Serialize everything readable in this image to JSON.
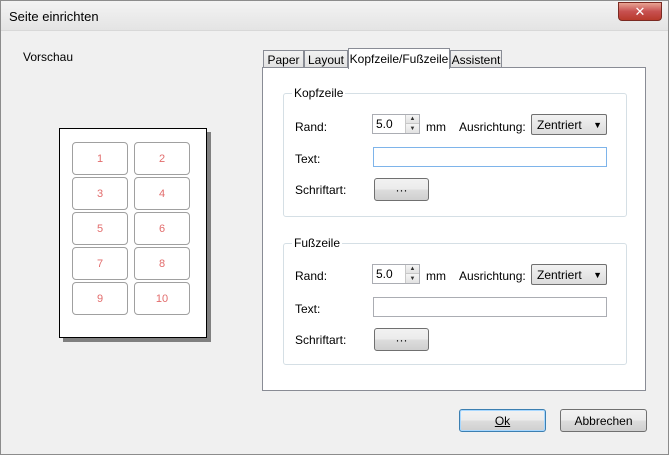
{
  "window": {
    "title": "Seite einrichten",
    "close_glyph": "✕"
  },
  "preview": {
    "label": "Vorschau",
    "cells": [
      "1",
      "2",
      "3",
      "4",
      "5",
      "6",
      "7",
      "8",
      "9",
      "10"
    ]
  },
  "tabs": [
    {
      "label": "Paper",
      "active": false
    },
    {
      "label": "Layout",
      "active": false
    },
    {
      "label": "Kopfzeile/Fußzeile",
      "active": true
    },
    {
      "label": "Assistent",
      "active": false
    }
  ],
  "header": {
    "group_title": "Kopfzeile",
    "margin_label": "Rand:",
    "margin_value": "5.0",
    "unit": "mm",
    "alignment_label": "Ausrichtung:",
    "alignment_value": "Zentriert",
    "text_label": "Text:",
    "text_value": "",
    "font_label": "Schriftart:",
    "font_button": "···"
  },
  "footer": {
    "group_title": "Fußzeile",
    "margin_label": "Rand:",
    "margin_value": "5.0",
    "unit": "mm",
    "alignment_label": "Ausrichtung:",
    "alignment_value": "Zentriert",
    "text_label": "Text:",
    "text_value": "",
    "font_label": "Schriftart:",
    "font_button": "···"
  },
  "buttons": {
    "ok_label": "Ok",
    "cancel_label": "Abbrechen"
  }
}
